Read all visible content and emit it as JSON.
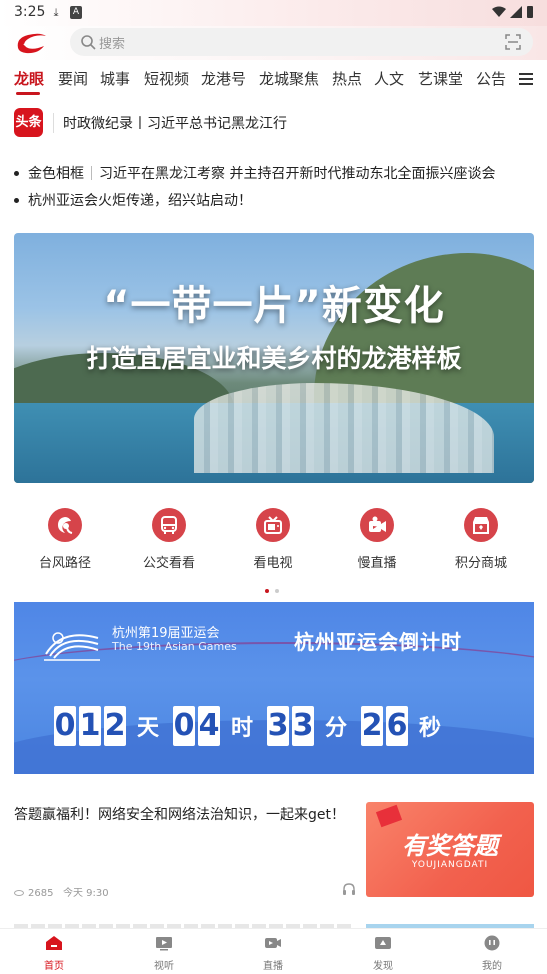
{
  "status_bar": {
    "time": "3:25"
  },
  "search": {
    "placeholder": "搜索"
  },
  "tabs": [
    "龙眼",
    "要闻",
    "城事",
    "短视频",
    "龙港号",
    "龙城聚焦",
    "热点",
    "人文",
    "艺课堂",
    "公告"
  ],
  "headline": {
    "badge": "头条",
    "text": "时政微纪录丨习近平总书记黑龙江行"
  },
  "bullets": [
    {
      "tag": "金色相框",
      "text": "习近平在黑龙江考察 并主持召开新时代推动东北全面振兴座谈会"
    },
    {
      "text": "杭州亚运会火炬传递，绍兴站启动！"
    }
  ],
  "banner": {
    "title": "“一带一片”新变化",
    "subtitle": "打造宜居宜业和美乡村的龙港样板"
  },
  "quick_links": [
    "台风路径",
    "公交看看",
    "看电视",
    "慢直播",
    "积分商城"
  ],
  "asian_games": {
    "name_cn": "杭州第19届亚运会",
    "name_en": "The 19th Asian Games",
    "countdown_title": "杭州亚运会倒计时",
    "days": "012",
    "days_unit": "天",
    "hours": "04",
    "hours_unit": "时",
    "minutes": "33",
    "minutes_unit": "分",
    "seconds": "26",
    "seconds_unit": "秒"
  },
  "news": {
    "title": "答题赢福利！网络安全和网络法治知识，一起来get！",
    "views": "2685",
    "time": "今天 9:30",
    "thumb_title": "有奖答题",
    "thumb_sub": "YOUJIANGDATI"
  },
  "bottom_nav": [
    "首页",
    "视听",
    "直播",
    "发现",
    "我的"
  ],
  "colors": {
    "brand_red": "#c8161e",
    "asian_blue": "#4f86e6"
  }
}
